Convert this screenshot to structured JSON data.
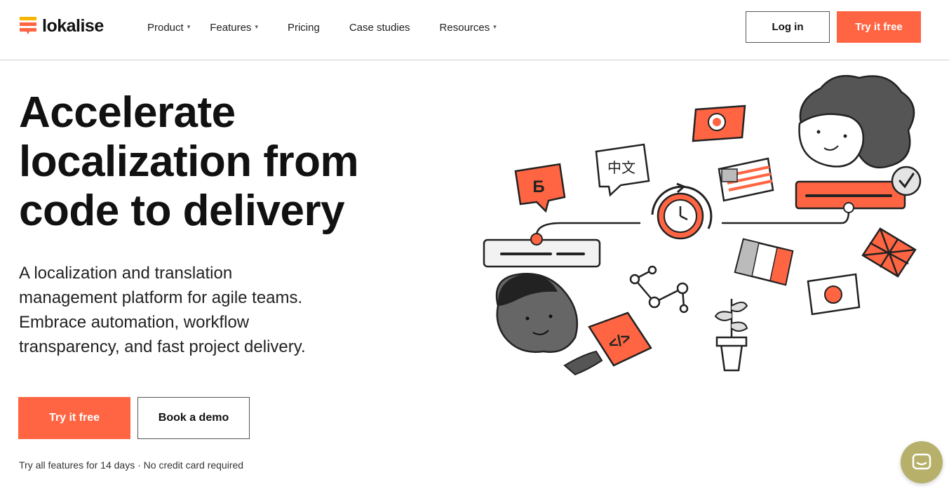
{
  "brand": {
    "name": "lokalise",
    "accent": "#ff6542"
  },
  "nav": {
    "items": [
      {
        "label": "Product",
        "has_dropdown": true
      },
      {
        "label": "Features",
        "has_dropdown": true
      },
      {
        "label": "Pricing",
        "has_dropdown": false
      },
      {
        "label": "Case studies",
        "has_dropdown": false
      },
      {
        "label": "Resources",
        "has_dropdown": true
      }
    ],
    "login_label": "Log in",
    "try_label": "Try it free"
  },
  "hero": {
    "headline_lines": [
      "Accelerate",
      "localization from",
      "code to delivery"
    ],
    "subtext_lines": [
      "A localization and translation",
      "management platform for agile teams.",
      "Embrace automation, workflow",
      "transparency, and fast project delivery."
    ],
    "primary_cta": "Try it free",
    "secondary_cta": "Book a demo",
    "note": "Try all features for 14 days · No credit card required"
  },
  "illustration": {
    "bubble_letter": "Б",
    "bubble_chinese": "中文",
    "code_glyph": "</>",
    "icons": [
      "person-icon",
      "flag-japan-icon",
      "flag-usa-icon",
      "flag-france-icon",
      "flag-uk-icon",
      "clock-icon",
      "plant-icon",
      "checkmark-icon",
      "network-icon"
    ]
  },
  "chat": {
    "icon": "chat-icon",
    "color": "#b6b06a"
  }
}
